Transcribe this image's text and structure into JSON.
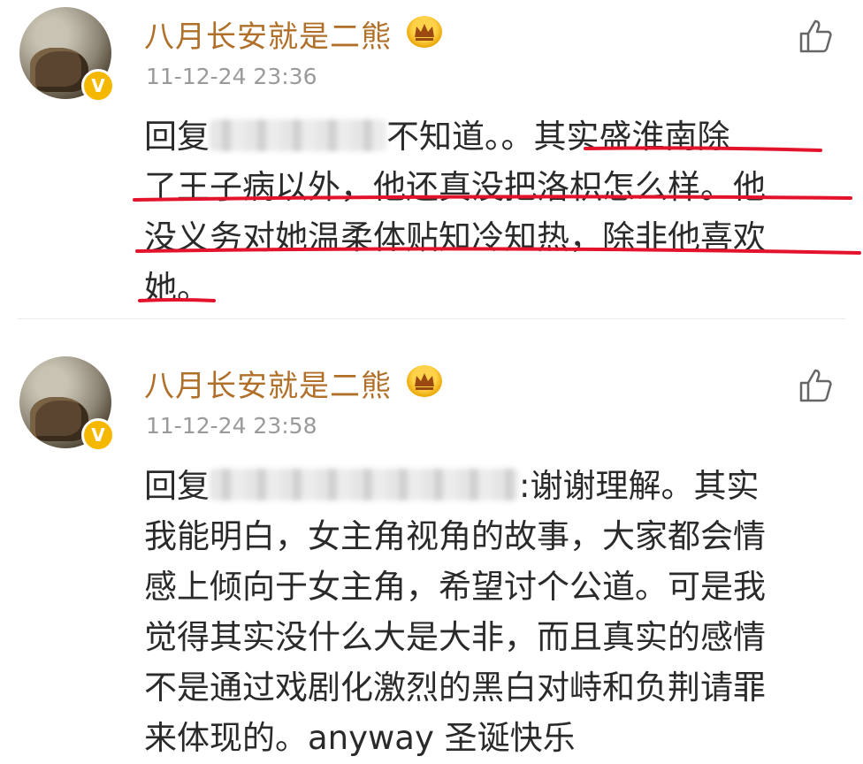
{
  "comments": [
    {
      "username": "八月长安就是二熊",
      "timestamp": "11-12-24 23:36",
      "reply_prefix": "回复",
      "lines": [
        "不知道。。其实盛淮南除",
        "了王子病以外，他还真没把洛枳怎么样。他",
        "没义务对她温柔体贴知冷知热，除非他喜欢",
        "她。"
      ]
    },
    {
      "username": "八月长安就是二熊",
      "timestamp": "11-12-24 23:58",
      "reply_prefix": "回复",
      "lines": [
        ":谢谢理解。其实",
        "我能明白，女主角视角的故事，大家都会情",
        "感上倾向于女主角，希望讨个公道。可是我",
        "觉得其实没什么大是大非，而且真实的感情",
        "不是通过戏剧化激烈的黑白对峙和负荆请罪",
        "来体现的。anyway 圣诞快乐"
      ]
    }
  ],
  "icons": {
    "verified": "verified-v-badge",
    "member": "crown-icon",
    "like": "thumbs-up-icon"
  },
  "colors": {
    "username": "#b0702a",
    "timestamp": "#9a9a9a",
    "underline": "#e3132b",
    "verified": "#f5b800"
  }
}
